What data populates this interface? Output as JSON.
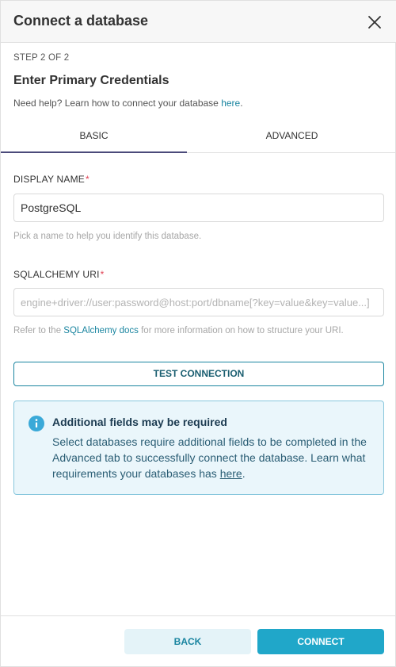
{
  "modal": {
    "title": "Connect a database",
    "step": "STEP 2 OF 2",
    "subtitle": "Enter Primary Credentials",
    "help_text": "Need help? Learn how to connect your database ",
    "help_link": "here",
    "help_suffix": "."
  },
  "tabs": [
    {
      "label": "BASIC",
      "active": true
    },
    {
      "label": "ADVANCED",
      "active": false
    }
  ],
  "form": {
    "display_name": {
      "label": "DISPLAY NAME",
      "required_mark": "*",
      "value": "PostgreSQL",
      "hint": "Pick a name to help you identify this database."
    },
    "sqlalchemy_uri": {
      "label": "SQLALCHEMY URI",
      "required_mark": "*",
      "value": "",
      "placeholder": "engine+driver://user:password@host:port/dbname[?key=value&key=value...]",
      "hint_prefix": "Refer to the ",
      "hint_link": "SQLAlchemy docs",
      "hint_suffix": " for more information on how to structure your URI."
    },
    "test_button": "TEST CONNECTION"
  },
  "alert": {
    "title": "Additional fields may be required",
    "body": "Select databases require additional fields to be completed in the Advanced tab to successfully connect the database. Learn what requirements your databases has ",
    "link": "here",
    "suffix": ".",
    "icon": "info-icon"
  },
  "footer": {
    "back_label": "BACK",
    "connect_label": "CONNECT"
  },
  "colors": {
    "accent": "#20a7c9",
    "link": "#1a85a0",
    "required": "#e04355",
    "active_tab": "#4b4a7a"
  }
}
